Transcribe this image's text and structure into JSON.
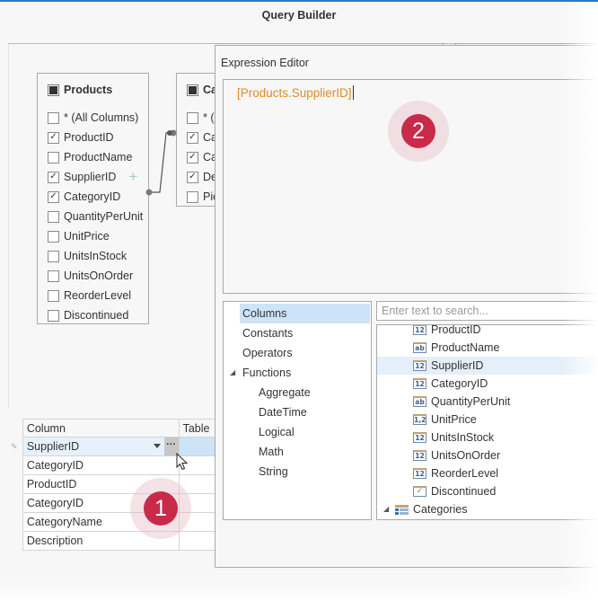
{
  "window": {
    "title": "Query Builder",
    "accent_color": "#2b78c5"
  },
  "diagram": {
    "tables": [
      {
        "name": "Products",
        "columns": [
          {
            "label": "* (All Columns)",
            "checked": false
          },
          {
            "label": "ProductID",
            "checked": true
          },
          {
            "label": "ProductName",
            "checked": false
          },
          {
            "label": "SupplierID",
            "checked": true
          },
          {
            "label": "CategoryID",
            "checked": true
          },
          {
            "label": "QuantityPerUnit",
            "checked": false
          },
          {
            "label": "UnitPrice",
            "checked": false
          },
          {
            "label": "UnitsInStock",
            "checked": false
          },
          {
            "label": "UnitsOnOrder",
            "checked": false
          },
          {
            "label": "ReorderLevel",
            "checked": false
          },
          {
            "label": "Discontinued",
            "checked": false
          }
        ]
      },
      {
        "name": "Ca",
        "columns": [
          {
            "label": "* (A",
            "checked": false
          },
          {
            "label": "Ca",
            "checked": true
          },
          {
            "label": "Ca",
            "checked": true
          },
          {
            "label": "De",
            "checked": true
          },
          {
            "label": "Pic",
            "checked": false
          }
        ]
      }
    ],
    "add_icon": "plus-icon"
  },
  "grid": {
    "headers": {
      "column": "Column",
      "table": "Table"
    },
    "rows": [
      {
        "column": "SupplierID",
        "table": "",
        "selected": true
      },
      {
        "column": "CategoryID",
        "table": ""
      },
      {
        "column": "ProductID",
        "table": ""
      },
      {
        "column": "CategoryID",
        "table": ""
      },
      {
        "column": "CategoryName",
        "table": ""
      },
      {
        "column": "Description",
        "table": ""
      }
    ],
    "ellipsis_label": "···"
  },
  "badges": {
    "one": "1",
    "two": "2",
    "color": "#c92a4a"
  },
  "editor": {
    "title": "Expression Editor",
    "expression": "[Products.SupplierID]",
    "expression_color": "#e08a2a",
    "categories": [
      {
        "label": "Columns",
        "selected": true
      },
      {
        "label": "Constants"
      },
      {
        "label": "Operators"
      },
      {
        "label": "Functions",
        "expanded": true
      },
      {
        "label": "Aggregate",
        "child": true
      },
      {
        "label": "DateTime",
        "child": true
      },
      {
        "label": "Logical",
        "child": true
      },
      {
        "label": "Math",
        "child": true
      },
      {
        "label": "String",
        "child": true
      }
    ],
    "search_placeholder": "Enter text to search...",
    "fields": [
      {
        "label": "ProductID",
        "type": "12"
      },
      {
        "label": "ProductName",
        "type": "ab"
      },
      {
        "label": "SupplierID",
        "type": "12",
        "selected": true
      },
      {
        "label": "CategoryID",
        "type": "12"
      },
      {
        "label": "QuantityPerUnit",
        "type": "ab"
      },
      {
        "label": "UnitPrice",
        "type": "1,2"
      },
      {
        "label": "UnitsInStock",
        "type": "12"
      },
      {
        "label": "UnitsOnOrder",
        "type": "12"
      },
      {
        "label": "ReorderLevel",
        "type": "12"
      },
      {
        "label": "Discontinued",
        "type": "✓"
      }
    ],
    "table_node": {
      "label": "Categories",
      "expanded": true
    }
  }
}
